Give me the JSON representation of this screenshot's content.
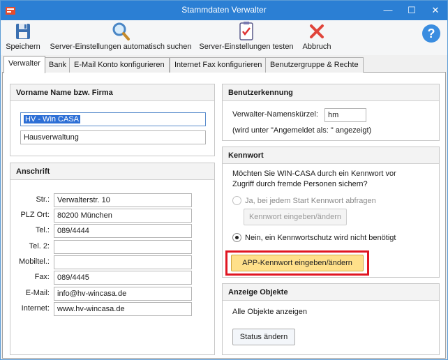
{
  "window": {
    "title": "Stammdaten Verwalter",
    "minimize": "—",
    "maximize": "☐",
    "close": "✕"
  },
  "toolbar": {
    "save": "Speichern",
    "auto_search": "Server-Einstellungen automatisch suchen",
    "test": "Server-Einstellungen testen",
    "cancel": "Abbruch",
    "help": "?"
  },
  "tabs": [
    "Verwalter",
    "Bank",
    "E-Mail Konto konfigurieren",
    "Internet Fax konfigurieren",
    "Benutzergruppe & Rechte"
  ],
  "name_group": {
    "header": "Vorname Name bzw. Firma",
    "line1": "HV - Win CASA",
    "line2": "Hausverwaltung"
  },
  "address": {
    "header": "Anschrift",
    "labels": {
      "street": "Str.:",
      "plz": "PLZ Ort:",
      "tel": "Tel.:",
      "tel2": "Tel. 2:",
      "mobile": "Mobiltel.:",
      "fax": "Fax:",
      "email": "E-Mail:",
      "internet": "Internet:"
    },
    "values": {
      "street": "Verwalterstr. 10",
      "plz": "80200 München",
      "tel": "089/4444",
      "tel2": "",
      "mobile": "",
      "fax": "089/4445",
      "email": "info@hv-wincasa.de",
      "internet": "www.hv-wincasa.de"
    }
  },
  "user_id": {
    "header": "Benutzerkennung",
    "short_label": "Verwalter-Namenskürzel:",
    "short_value": "hm",
    "note": "(wird unter \"Angemeldet als: \" angezeigt)"
  },
  "password": {
    "header": "Kennwort",
    "question": "Möchten Sie WIN-CASA durch ein Kennwort vor Zugriff durch fremde Personen sichern?",
    "question_line1": "Möchten Sie WIN-CASA durch ein Kennwort vor",
    "question_line2": "Zugriff durch fremde Personen sichern?",
    "option_yes": "Ja, bei jedem Start Kennwort abfragen",
    "enter_button": "Kennwort eingeben/ändern",
    "option_no": "Nein, ein Kennwortschutz wird nicht benötigt",
    "app_button": "APP-Kennwort eingeben/ändern",
    "selected": "no"
  },
  "objects": {
    "header": "Anzeige Objekte",
    "text": "Alle Objekte anzeigen",
    "status_button": "Status ändern"
  },
  "colors": {
    "titlebar": "#2b7fd4",
    "highlight_frame": "#e01622",
    "app_button": "#ffe08a",
    "selection": "#2d6fd6"
  }
}
